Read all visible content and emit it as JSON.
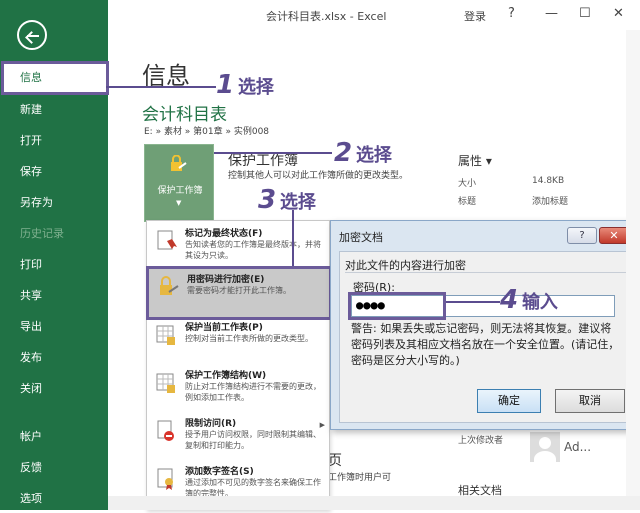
{
  "window": {
    "title": "会计科目表.xlsx - Excel",
    "login": "登录",
    "help": "?",
    "minimize": "—",
    "restore": "☐",
    "close": "✕"
  },
  "sidebar": {
    "items": [
      {
        "label": "信息",
        "state": "active"
      },
      {
        "label": "新建"
      },
      {
        "label": "打开"
      },
      {
        "label": "保存"
      },
      {
        "label": "另存为"
      },
      {
        "label": "历史记录",
        "state": "disabled"
      },
      {
        "label": "打印"
      },
      {
        "label": "共享"
      },
      {
        "label": "导出"
      },
      {
        "label": "发布"
      },
      {
        "label": "关闭"
      },
      {
        "label": "帐户"
      },
      {
        "label": "反馈"
      },
      {
        "label": "选项"
      }
    ]
  },
  "main": {
    "heading": "信息",
    "workbook_name": "会计科目表",
    "path": "E: » 素材 » 第01章 » 实例008",
    "protect_button": "保护工作簿",
    "protect_title": "保护工作簿",
    "protect_desc": "控制其他人可以对此工作簿所做的更改类型。",
    "properties": {
      "title": "属性 ▾",
      "size_label": "大小",
      "size_value": "14.8KB",
      "title_label": "标题",
      "title_value": "添加标题"
    },
    "last_modified_label": "上次修改者",
    "author": "Ad...",
    "related_docs": "相关文档",
    "fragment_large": "页",
    "fragment_small": "工作簿时用户可"
  },
  "menu": {
    "items": [
      {
        "title": "标记为最终状态(F)",
        "desc": "告知读者您的工作簿是最终版本，并将其设为只读。"
      },
      {
        "title": "用密码进行加密(E)",
        "desc": "需要密码才能打开此工作簿。"
      },
      {
        "title": "保护当前工作表(P)",
        "desc": "控制对当前工作表所做的更改类型。"
      },
      {
        "title": "保护工作簿结构(W)",
        "desc": "防止对工作簿结构进行不需要的更改，例如添加工作表。"
      },
      {
        "title": "限制访问(R)",
        "desc": "授予用户访问权限，同时限制其编辑、复制和打印能力。"
      },
      {
        "title": "添加数字签名(S)",
        "desc": "通过添加不可见的数字签名来确保工作簿的完整性。"
      }
    ]
  },
  "dialog": {
    "title": "加密文档",
    "help": "?",
    "close": "✕",
    "group": "对此文件的内容进行加密",
    "password_label": "密码(R):",
    "password_value": "●●●●",
    "warning": "警告: 如果丢失或忘记密码，则无法将其恢复。建议将密码列表及其相应文档名放在一个安全位置。(请记住，密码是区分大小写的。)",
    "ok": "确定",
    "cancel": "取消"
  },
  "annotations": [
    {
      "num": "1",
      "text": "选择"
    },
    {
      "num": "2",
      "text": "选择"
    },
    {
      "num": "3",
      "text": "选择"
    },
    {
      "num": "4",
      "text": "输入"
    }
  ],
  "colors": {
    "excel_green": "#207245",
    "annotation": "#5b4c8f",
    "protect_btn": "#6f9f76"
  }
}
